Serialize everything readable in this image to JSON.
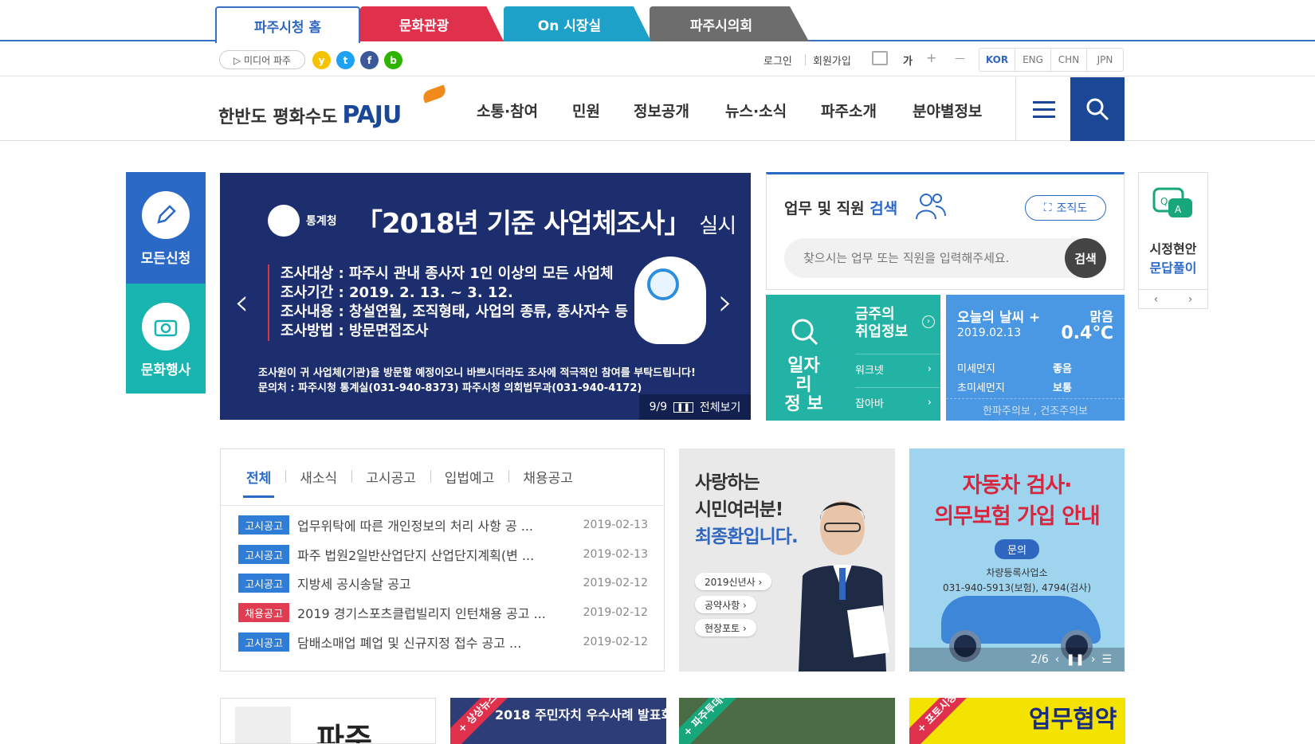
{
  "top_tabs": [
    "파주시청 홈",
    "문화관광",
    "On 시장실",
    "파주시의회"
  ],
  "util": {
    "media": "▷ 미디어 파주",
    "sns": [
      "y",
      "t",
      "f",
      "b"
    ],
    "login": "로그인",
    "join": "회원가입",
    "font_big": "가",
    "font_plus": "+",
    "font_minus": "—",
    "langs": [
      "KOR",
      "ENG",
      "CHN",
      "JPN"
    ]
  },
  "header": {
    "logo_text": "한반도 평화수도",
    "logo_brand": "PAJU",
    "gnb": [
      "소통·참여",
      "민원",
      "정보공개",
      "뉴스·소식",
      "파주소개",
      "분야별정보"
    ]
  },
  "quick": [
    "모든신청",
    "문화행사"
  ],
  "banner": {
    "agency": "통계청",
    "title": "「2018년 기준 사업체조사」",
    "title_suffix": "실시",
    "lines": [
      "조사대상 : 파주시 관내 종사자 1인 이상의 모든 사업체",
      "조사기간 : 2019. 2. 13. ~ 3. 12.",
      "조사내용 : 창설연월, 조직형태, 사업의 종류, 종사자수 등",
      "조사방법 : 방문면접조사"
    ],
    "note1": "조사원이 귀 사업체(기관)을 방문할 예정이오니 바쁘시더라도 조사에 적극적인 참여를 부탁드립니다!",
    "note2": "문의처 : 파주시청 통계실(031-940-8373) 파주시청 의회법무과(031-940-4172)",
    "pager": "9/9",
    "view_all": "전체보기"
  },
  "search": {
    "title_pre": "업무 및 직원",
    "title_post": "검색",
    "org_btn": "조직도",
    "placeholder": "찾으시는 업무 또는 직원을 입력해주세요.",
    "go": "검색"
  },
  "jobs": {
    "label1": "일자리",
    "label2": "정 보",
    "title1": "금주의",
    "title2": "취업정보",
    "links": [
      "워크넷",
      "잡아바"
    ]
  },
  "weather": {
    "title": "오늘의 날씨",
    "plus": "+",
    "date": "2019.02.13",
    "cond": "맑음",
    "temp": "0.4℃",
    "rows": [
      {
        "label": "미세먼지",
        "value": "좋음"
      },
      {
        "label": "초미세먼지",
        "value": "보통"
      }
    ],
    "warning": "한파주의보 , 건조주의보"
  },
  "right_mini": {
    "line1": "시정현안",
    "line2": "문답풀이"
  },
  "board": {
    "tabs": [
      "전체",
      "새소식",
      "고시공고",
      "입법예고",
      "채용공고"
    ],
    "rows": [
      {
        "badge": "고시공고",
        "color": "blue",
        "title": "업무위탁에 따른 개인정보의 처리 사항 공 ...",
        "date": "2019-02-13"
      },
      {
        "badge": "고시공고",
        "color": "blue",
        "title": "파주 법원2일반산업단지 산업단지계획(변 ...",
        "date": "2019-02-13"
      },
      {
        "badge": "고시공고",
        "color": "blue",
        "title": "지방세 공시송달 공고",
        "date": "2019-02-12"
      },
      {
        "badge": "채용공고",
        "color": "red",
        "title": "2019 경기스포츠클럽빌리지 인턴채용 공고 ...",
        "date": "2019-02-12"
      },
      {
        "badge": "고시공고",
        "color": "blue",
        "title": "담배소매업 폐업 및 신규지정 접수 공고 ...",
        "date": "2019-02-12"
      }
    ]
  },
  "mayor_card": {
    "line1": "사랑하는",
    "line2": "시민여러분!",
    "line3": "최종환입니다.",
    "pills": [
      "2019신년사 ›",
      "공약사항 ›",
      "현장포토 ›"
    ]
  },
  "car_card": {
    "line1": "자동차 검사·",
    "line2_red": "의무보험",
    "line2_rest": " 가입 안내",
    "pill": "문의",
    "info1": "차량등록사업소",
    "info2": "031-940-5913(보험), 4794(검사)",
    "pager": "2/6"
  },
  "bottom": [
    {
      "corner": "",
      "text": "파주"
    },
    {
      "corner": "+ 상상뉴스",
      "text": "2018 주민자치 우수사례 발표회"
    },
    {
      "corner": "+ 파주투데이",
      "text": ""
    },
    {
      "corner": "+ 포토시정",
      "text": "업무협약"
    }
  ],
  "colors": {
    "primary": "#2b69c7",
    "navy": "#1a4796",
    "red": "#e0314c",
    "teal": "#18b5b0"
  }
}
